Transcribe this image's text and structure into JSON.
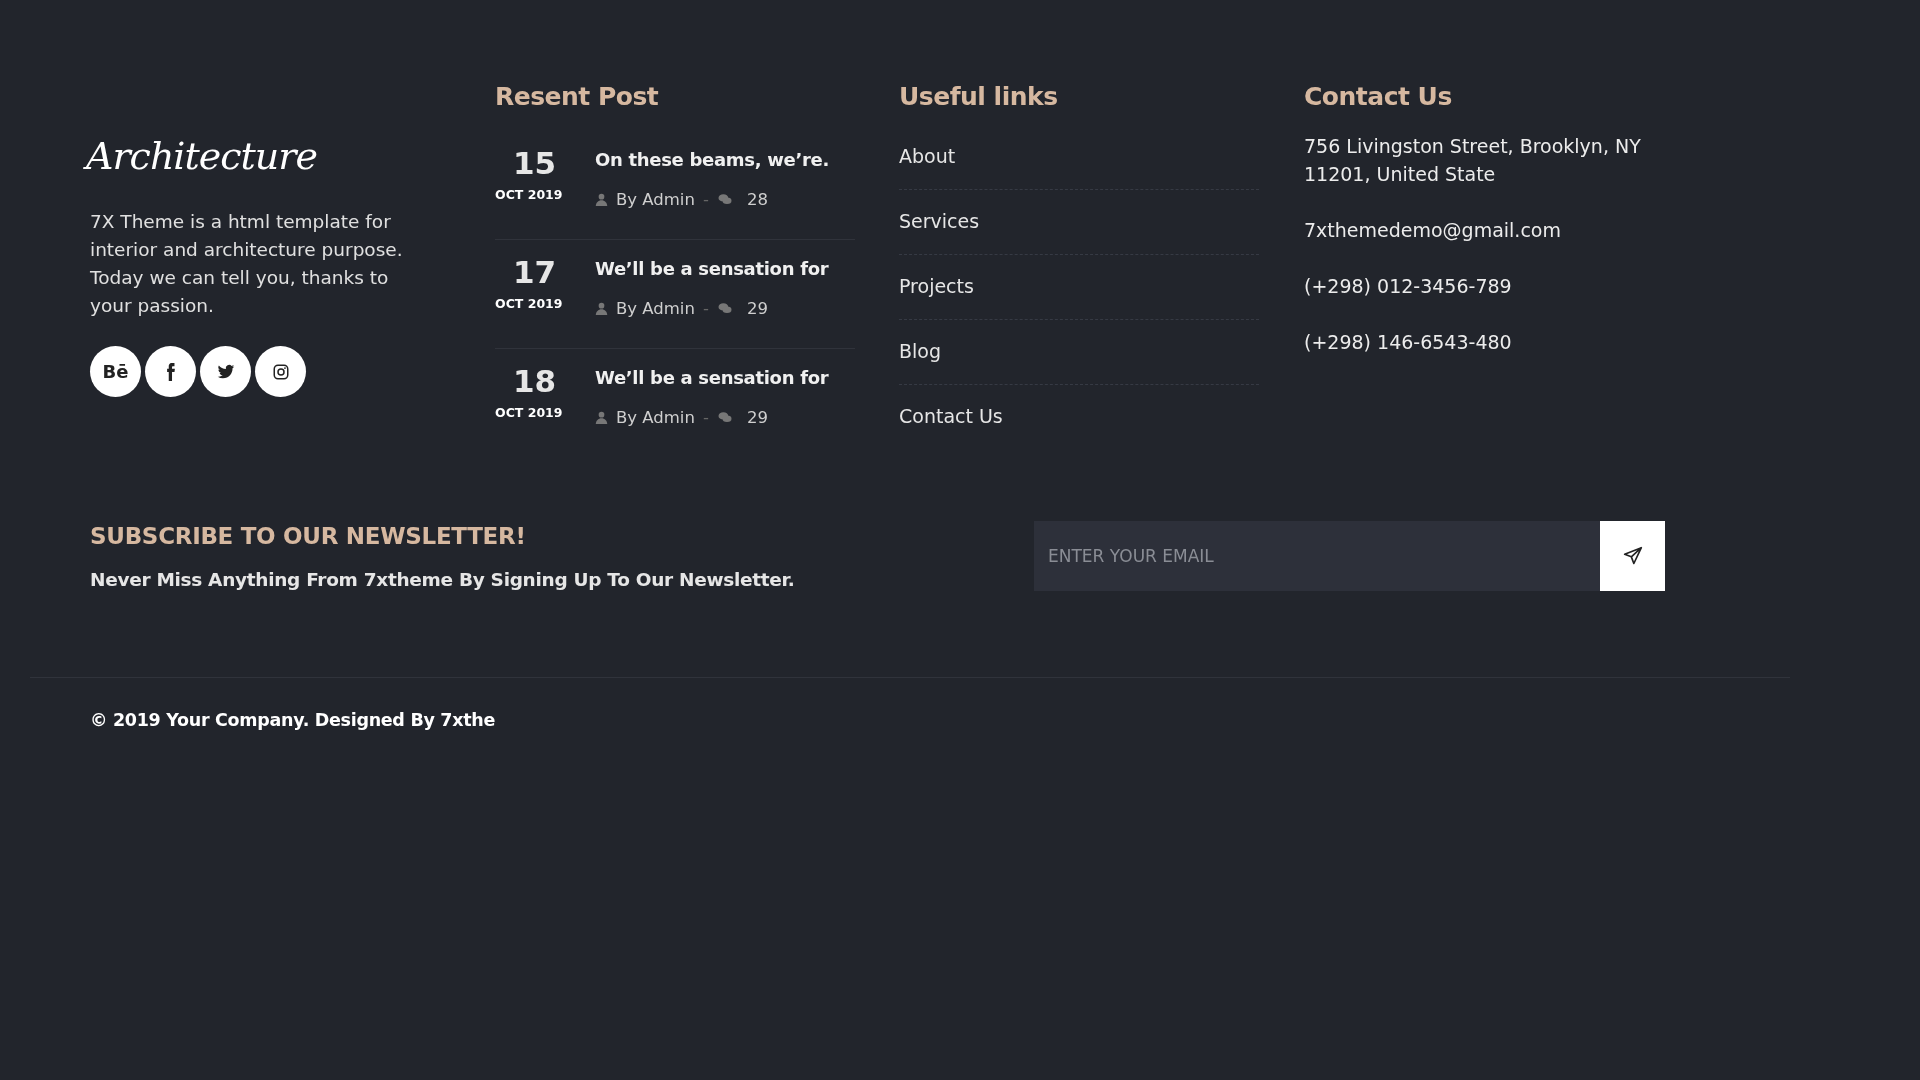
{
  "brand": {
    "logo": "Architecture",
    "about": "7X Theme is a html template for interior and architecture purpose. Today we can tell you, thanks to your passion.",
    "social": [
      {
        "kind": "behance",
        "label": "Bē"
      },
      {
        "kind": "facebook"
      },
      {
        "kind": "twitter"
      },
      {
        "kind": "instagram"
      }
    ]
  },
  "recent_posts": {
    "title": "Resent Post",
    "posts": [
      {
        "day": "15",
        "month_year": "OCT 2019",
        "title": "On these beams, we’re.",
        "author": "By Admin",
        "separator": "-",
        "comments": "28"
      },
      {
        "day": "17",
        "month_year": "OCT 2019",
        "title": "We’ll be a sensation for",
        "author": "By Admin",
        "separator": "-",
        "comments": "29"
      },
      {
        "day": "18",
        "month_year": "OCT 2019",
        "title": "We’ll be a sensation for",
        "author": "By Admin",
        "separator": "-",
        "comments": "29"
      }
    ]
  },
  "useful_links": {
    "title": "Useful links",
    "links": [
      "About",
      "Services",
      "Projects",
      "Blog",
      "Contact Us"
    ]
  },
  "contact": {
    "title": "Contact Us",
    "lines": [
      "756 Livingston Street, Brooklyn, NY 11201, United State",
      "7xthemedemo@gmail.com",
      "(+298) 012-3456-789",
      "(+298) 146-6543-480"
    ]
  },
  "newsletter": {
    "title": "SUBSCRIBE TO OUR NEWSLETTER!",
    "text": "Never Miss Anything From 7xtheme By Signing Up To Our Newsletter.",
    "placeholder": "ENTER YOUR EMAIL"
  },
  "copyright": "© 2019 Your Company. Designed By 7xthe"
}
